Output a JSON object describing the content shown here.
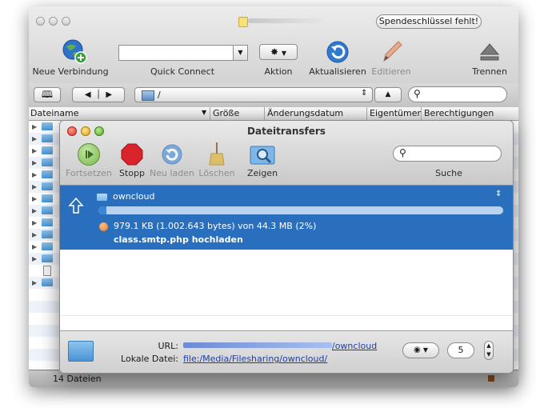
{
  "main": {
    "spende_label": "Spendeschlüssel fehlt!",
    "toolbar": {
      "new_connection": "Neue Verbindung",
      "quick_connect": "Quick Connect",
      "action": "Aktion",
      "refresh": "Aktualisieren",
      "edit": "Editieren",
      "disconnect": "Trennen"
    },
    "path": "/",
    "columns": {
      "name": "Dateiname",
      "size": "Größe",
      "modified": "Änderungsdatum",
      "owner": "Eigentümer",
      "permissions": "Berechtigungen"
    },
    "file_count": "14 Dateien"
  },
  "transfers": {
    "title": "Dateitransfers",
    "toolbar": {
      "resume": "Fortsetzen",
      "stop": "Stopp",
      "reload": "Neu laden",
      "delete": "Löschen",
      "show": "Zeigen",
      "search": "Suche"
    },
    "item": {
      "folder": "owncloud",
      "progress_fraction": 0.02,
      "status": "979.1 KB (1.002.643 bytes) von 44.3 MB (2%)",
      "action": "class.smtp.php hochladen"
    },
    "footer": {
      "url_label": "URL:",
      "url_value": "/owncloud",
      "local_label": "Lokale Datei:",
      "local_value": "file:/Media/Filesharing/owncloud/",
      "connections": "5"
    }
  },
  "colors": {
    "selection": "#2a6fbd",
    "stop": "#d8242a",
    "resume": "#78b94a"
  }
}
